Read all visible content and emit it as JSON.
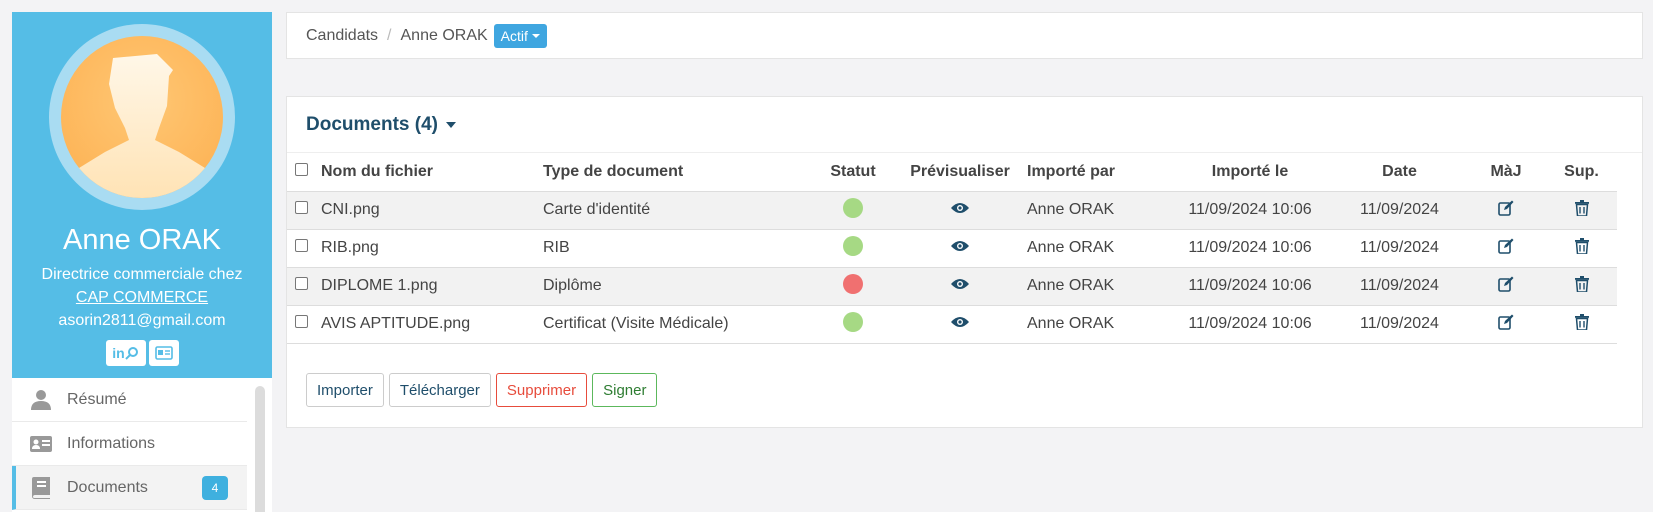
{
  "profile": {
    "name": "Anne ORAK",
    "role": "Directrice commerciale chez",
    "company": "CAP COMMERCE",
    "email": "asorin2811@gmail.com",
    "linkedin_label": "in",
    "accent_color": "#55bde6"
  },
  "nav": {
    "items": [
      {
        "label": "Résumé",
        "icon": "user-icon"
      },
      {
        "label": "Informations",
        "icon": "id-card-icon"
      },
      {
        "label": "Documents",
        "icon": "book-icon",
        "badge": "4",
        "active": true
      }
    ]
  },
  "breadcrumb": {
    "root": "Candidats",
    "separator": "/",
    "current": "Anne ORAK",
    "status": "Actif"
  },
  "documents": {
    "title": "Documents (4)",
    "columns": [
      "Nom du fichier",
      "Type de document",
      "Statut",
      "Prévisualiser",
      "Importé par",
      "Importé le",
      "Date",
      "MàJ",
      "Sup."
    ],
    "rows": [
      {
        "file": "CNI.png",
        "type": "Carte d'identité",
        "status_color": "#a6d984",
        "imported_by": "Anne ORAK",
        "imported_at": "11/09/2024 10:06",
        "date": "11/09/2024"
      },
      {
        "file": "RIB.png",
        "type": "RIB",
        "status_color": "#a6d984",
        "imported_by": "Anne ORAK",
        "imported_at": "11/09/2024 10:06",
        "date": "11/09/2024"
      },
      {
        "file": "DIPLOME 1.png",
        "type": "Diplôme",
        "status_color": "#f07070",
        "imported_by": "Anne ORAK",
        "imported_at": "11/09/2024 10:06",
        "date": "11/09/2024"
      },
      {
        "file": "AVIS APTITUDE.png",
        "type": "Certificat (Visite Médicale)",
        "status_color": "#a6d984",
        "imported_by": "Anne ORAK",
        "imported_at": "11/09/2024 10:06",
        "date": "11/09/2024"
      }
    ],
    "buttons": {
      "import": "Importer",
      "download": "Télécharger",
      "delete": "Supprimer",
      "sign": "Signer"
    }
  }
}
